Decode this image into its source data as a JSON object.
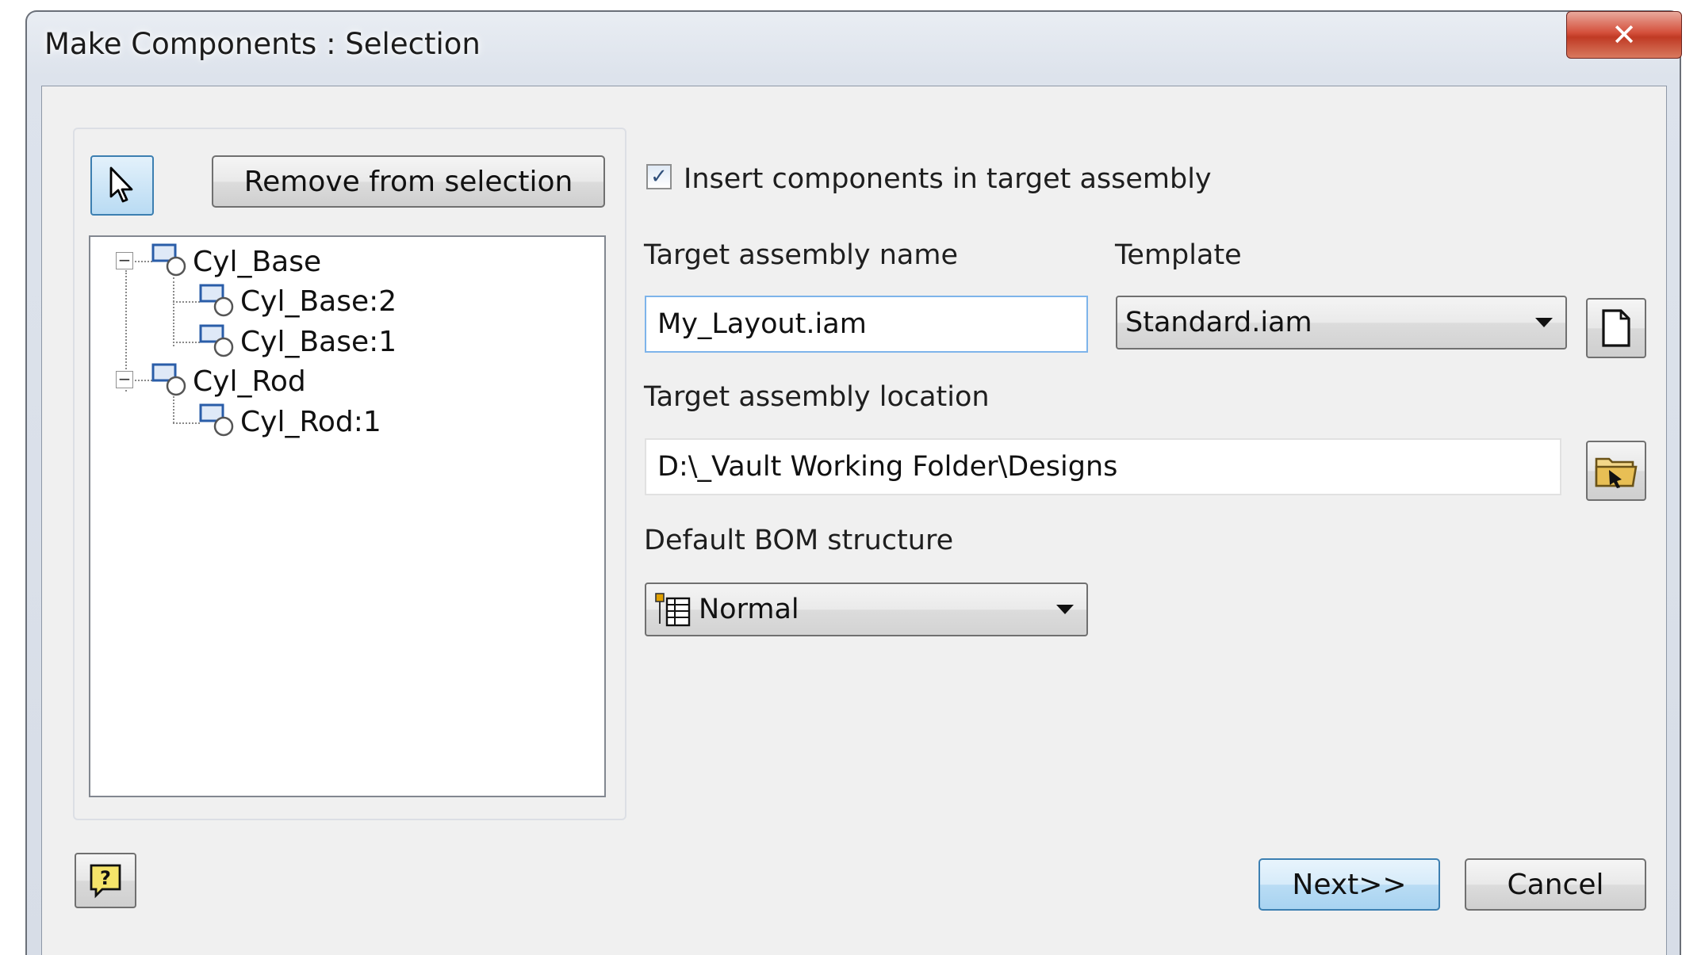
{
  "window": {
    "title": "Make Components : Selection",
    "close_icon": "close-icon"
  },
  "selection": {
    "select_tool_icon": "pointer-arrow-icon",
    "remove_button": "Remove from selection",
    "tree": [
      {
        "label": "Cyl_Base",
        "expanded": true,
        "children": [
          "Cyl_Base:2",
          "Cyl_Base:1"
        ]
      },
      {
        "label": "Cyl_Rod",
        "expanded": true,
        "children": [
          "Cyl_Rod:1"
        ]
      }
    ]
  },
  "options": {
    "insert_checkbox_label": "Insert components in target assembly",
    "insert_checked": true,
    "target_name_label": "Target assembly name",
    "target_name_value": "My_Layout.iam",
    "template_label": "Template",
    "template_value": "Standard.iam",
    "location_label": "Target assembly location",
    "location_value": "D:\\_Vault Working Folder\\Designs",
    "bom_label": "Default BOM structure",
    "bom_value": "Normal"
  },
  "footer": {
    "next_button": "Next>>",
    "cancel_button": "Cancel"
  },
  "colors": {
    "accent": "#3c7fb1",
    "close_red": "#c03a24"
  }
}
